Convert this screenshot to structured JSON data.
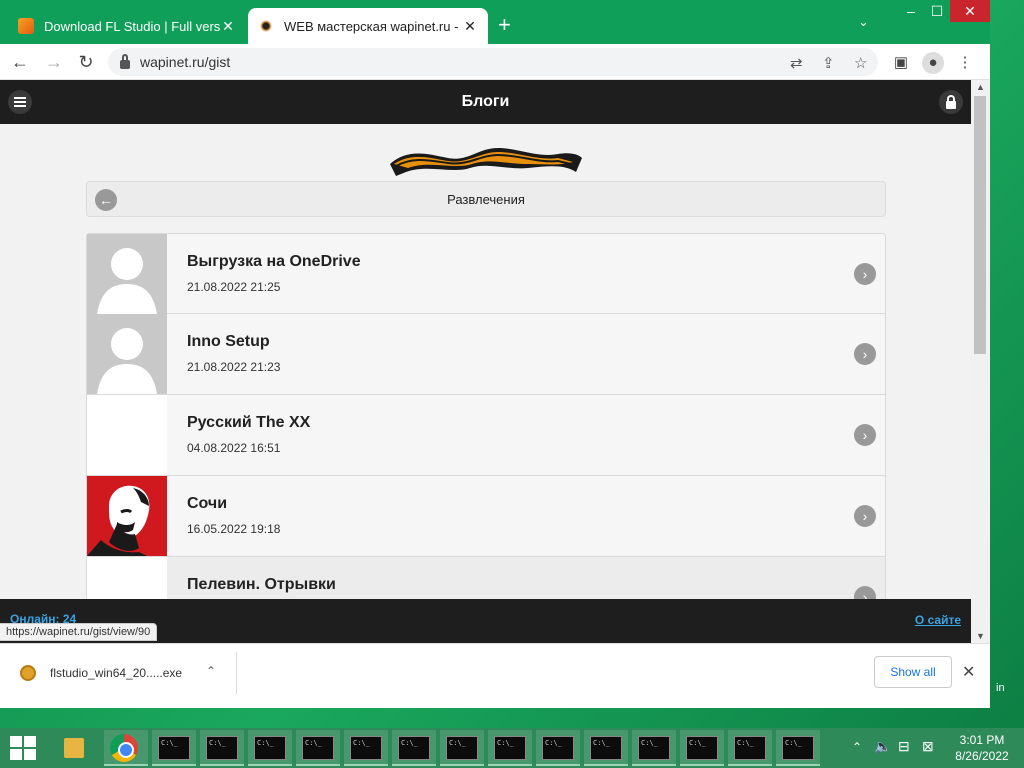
{
  "browser": {
    "tabs": [
      {
        "title": "Download FL Studio | Full versio",
        "active": false
      },
      {
        "title": "WEB мастерская wapinet.ru - Бл",
        "active": true
      }
    ],
    "new_tab_label": "+",
    "url": "wapinet.ru/gist"
  },
  "site": {
    "header_title": "Блоги",
    "section_title": "Развлечения",
    "posts": [
      {
        "title": "Выгрузка на OneDrive",
        "date": "21.08.2022 21:25"
      },
      {
        "title": "Inno Setup",
        "date": "21.08.2022 21:23"
      },
      {
        "title": "Русский The XX",
        "date": "04.08.2022 16:51"
      },
      {
        "title": "Сочи",
        "date": "16.05.2022 19:18"
      },
      {
        "title": "Пелевин. Отрывки",
        "date": ""
      }
    ],
    "footer_online": "Онлайн: 24",
    "footer_about": "О сайте",
    "status_url": "https://wapinet.ru/gist/view/90"
  },
  "download_bar": {
    "file_name": "flstudio_win64_20.....exe",
    "show_all_label": "Show all"
  },
  "desktop_text": "in",
  "taskbar": {
    "time": "3:01 PM",
    "date": "8/26/2022",
    "cmd_label": "C:\\_"
  },
  "colors": {
    "window_frame": "#0f9f59",
    "site_header": "#1e1e1e",
    "link": "#3aa3e0",
    "taskbar": "#2f8a5a"
  }
}
